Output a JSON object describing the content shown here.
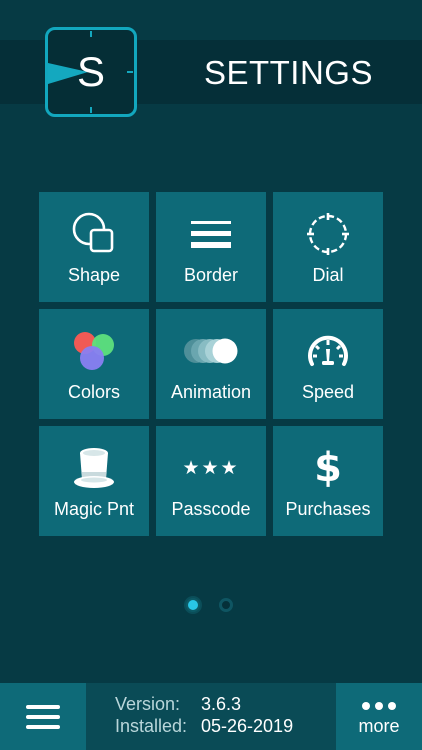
{
  "header": {
    "title": "SETTINGS",
    "logo_letter": "S"
  },
  "tiles": [
    {
      "label": "Shape",
      "icon": "shape-icon"
    },
    {
      "label": "Border",
      "icon": "border-icon"
    },
    {
      "label": "Dial",
      "icon": "dial-icon"
    },
    {
      "label": "Colors",
      "icon": "colors-icon"
    },
    {
      "label": "Animation",
      "icon": "animation-icon"
    },
    {
      "label": "Speed",
      "icon": "speed-icon"
    },
    {
      "label": "Magic Pnt",
      "icon": "top-hat-icon"
    },
    {
      "label": "Passcode",
      "icon": "passcode-stars-icon",
      "glyph": "★★★"
    },
    {
      "label": "Purchases",
      "icon": "dollar-icon",
      "glyph": "$"
    }
  ],
  "pager": {
    "pages": 2,
    "current": 1
  },
  "footer": {
    "version_label": "Version:",
    "version_value": "3.6.3",
    "installed_label": "Installed:",
    "installed_value": "05-26-2019",
    "more_label": "more"
  },
  "colors": {
    "background": "#063a44",
    "tile": "#0e6a78",
    "accent": "#12a7be",
    "dot_active": "#29c6e6"
  }
}
